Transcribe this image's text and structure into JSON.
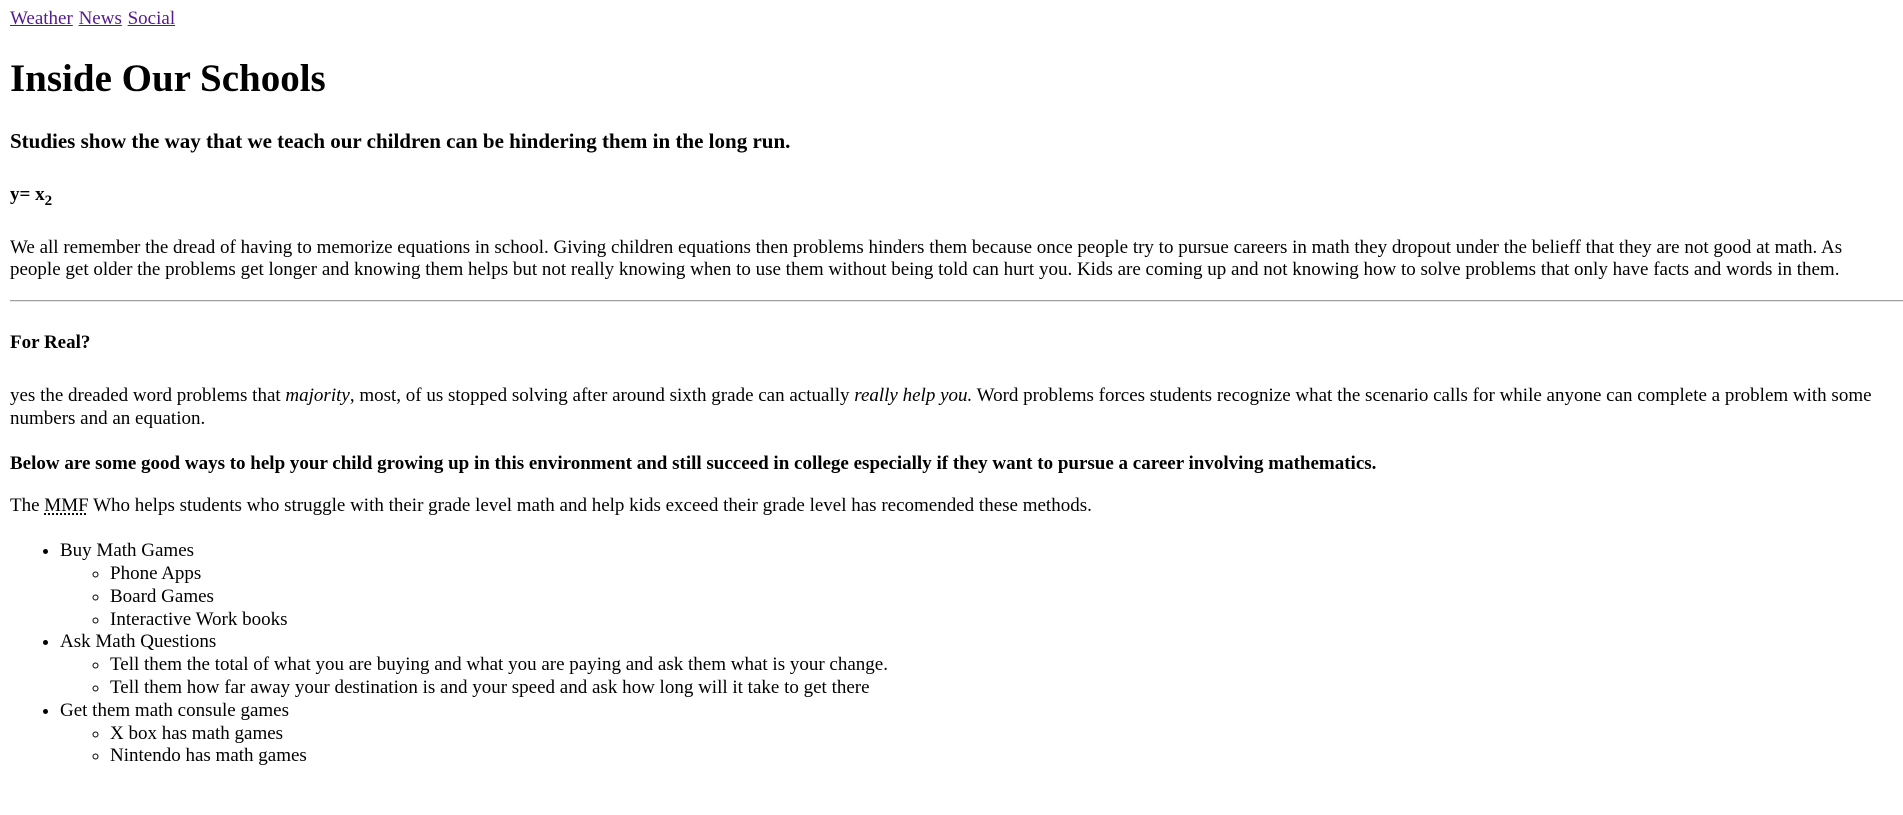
{
  "nav": {
    "links": [
      "Weather",
      "News",
      "Social"
    ]
  },
  "article": {
    "title": "Inside Our Schools",
    "subtitle": "Studies show the way that we teach our children can be hindering them in the long run.",
    "equation": {
      "base": "y= x",
      "subscript": "2"
    },
    "intro": "We all remember the dread of having to memorize equations in school. Giving children equations then problems hinders them because once people try to pursue careers in math they dropout under the belieff that they are not good at math. As people get older the problems get longer and knowing them helps but not really knowing when to use them without being told can hurt you. Kids are coming up and not knowing how to solve problems that only have facts and words in them.",
    "section_heading": "For Real?",
    "word_problems": {
      "part1": "yes the dreaded word problems that ",
      "em1": "majority",
      "part2": ", most, of us stopped solving after around sixth grade can actually ",
      "em2": "really help you.",
      "part3": " Word problems forces students recognize what the scenario calls for while anyone can complete a problem with some numbers and an equation."
    },
    "tips_heading": "Below are some good ways to help your child growing up in this environment and still succeed in college especially if they want to pursue a career involving mathematics.",
    "mmf": {
      "before": "The ",
      "abbr": "MMF",
      "after": " Who helps students who struggle with their grade level math and help kids exceed their grade level has recomended these methods."
    },
    "methods": [
      {
        "label": "Buy Math Games",
        "items": [
          "Phone Apps",
          "Board Games",
          "Interactive Work books"
        ]
      },
      {
        "label": "Ask Math Questions",
        "items": [
          "Tell them the total of what you are buying and what you are paying and ask them what is your change.",
          "Tell them how far away your destination is and your speed and ask how long will it take to get there"
        ]
      },
      {
        "label": "Get them math consule games",
        "items": [
          "X box has math games",
          "Nintendo has math games"
        ]
      }
    ]
  }
}
